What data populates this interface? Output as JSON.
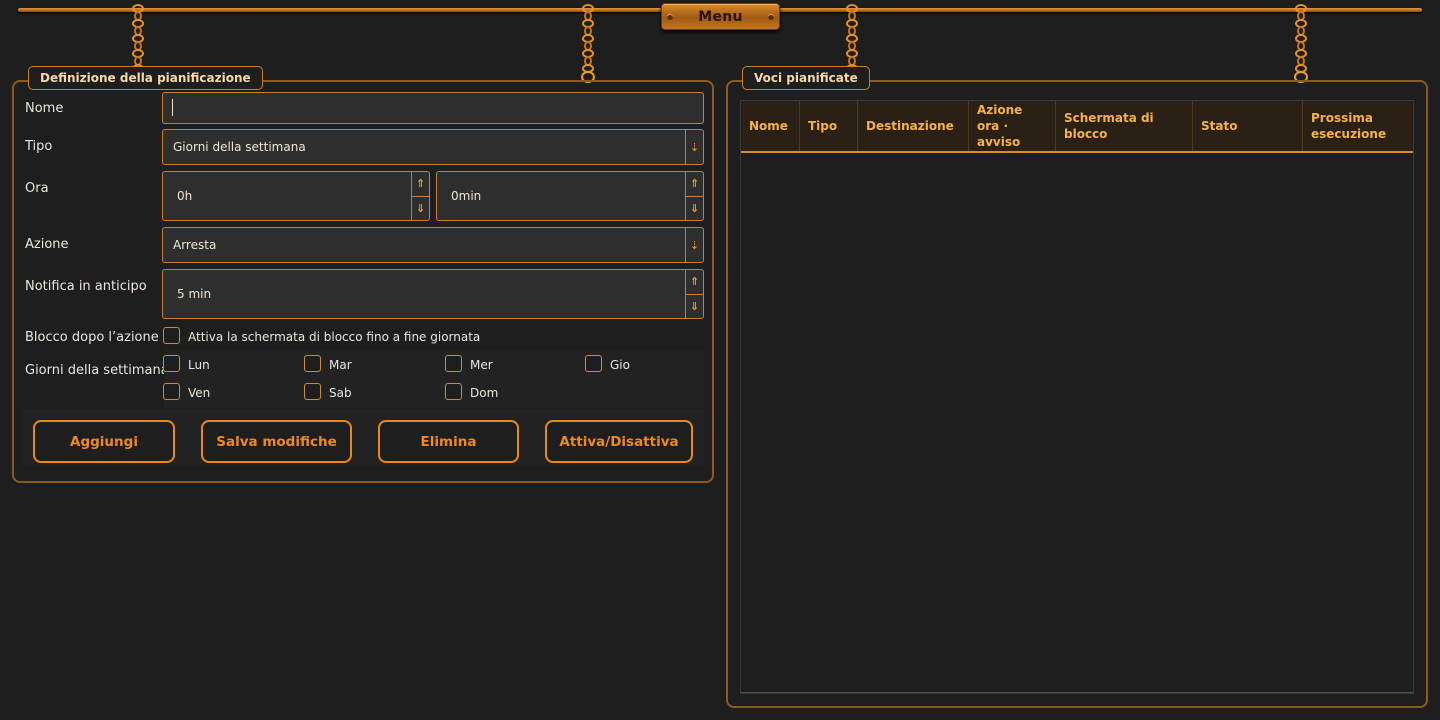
{
  "menu": {
    "label": "Menu"
  },
  "schedule_form": {
    "title": "Definizione della pianificazione",
    "name": {
      "label": "Nome",
      "value": ""
    },
    "type": {
      "label": "Tipo",
      "value": "Giorni della settimana"
    },
    "time": {
      "label": "Ora",
      "hours": "0h",
      "minutes": "0min"
    },
    "action": {
      "label": "Azione",
      "value": "Arresta"
    },
    "notify": {
      "label": "Notifica in anticipo",
      "value": "5 min"
    },
    "lock": {
      "label": "Blocco dopo l’azione",
      "checkbox_label": "Attiva la schermata di blocco fino a fine giornata",
      "checked": false
    },
    "weekdays": {
      "label": "Giorni della settimana",
      "days": [
        "Lun",
        "Mar",
        "Mer",
        "Gio",
        "Ven",
        "Sab",
        "Dom"
      ]
    },
    "buttons": {
      "add": "Aggiungi",
      "save": "Salva modifiche",
      "delete": "Elimina",
      "toggle": "Attiva/Disattiva"
    }
  },
  "scheduled_items": {
    "title": "Voci pianificate",
    "columns": [
      "Nome",
      "Tipo",
      "Destinazione",
      "Azione\nora · avviso",
      "Schermata di blocco",
      "Stato",
      "Prossima\nesecuzione"
    ],
    "rows": []
  },
  "colors": {
    "accent": "#e8891f",
    "background": "#1e1e1e",
    "field_bg": "#2e2e2e",
    "header_text": "#f5b24a"
  },
  "icons": {
    "dropdown": "dropdown-arrow-icon",
    "spin_up": "spin-up-icon",
    "spin_down": "spin-down-icon"
  }
}
